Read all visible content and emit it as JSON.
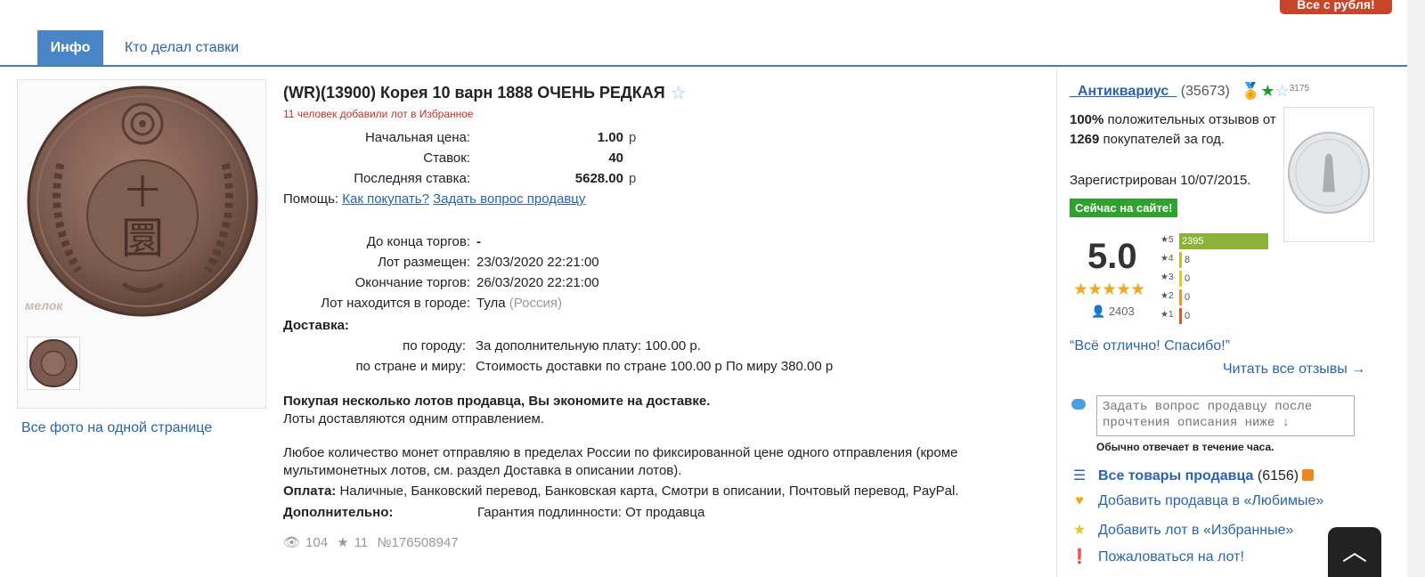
{
  "badge": "Все с рубля!",
  "tabs": [
    {
      "label": "Инфо"
    },
    {
      "label": "Кто делал ставки"
    }
  ],
  "photos": {
    "all_photos_label": "Все фото на одной странице",
    "watermark": "мелок"
  },
  "lot": {
    "title": "(WR)(13900) Корея 10 варн 1888 ОЧЕНЬ РЕДКАЯ",
    "fav_count_text": "11 человек добавили лот в Избранное",
    "start_price_label": "Начальная цена:",
    "start_price": "1.00",
    "bids_label": "Ставок:",
    "bids": "40",
    "last_bid_label": "Последняя ставка:",
    "last_bid": "5628.00",
    "currency": "р",
    "help_label": "Помощь:",
    "help_link_1": "Как покупать?",
    "help_link_2": "Задать вопрос продавцу",
    "ends_in_label": "До конца торгов:",
    "ends_in": "-",
    "placed_label": "Лот размещен:",
    "placed": "23/03/2020 22:21:00",
    "end_label": "Окончание торгов:",
    "end": "26/03/2020 22:21:00",
    "city_label": "Лот находится в городе:",
    "city": "Тула",
    "country": "(Россия)",
    "delivery_label": "Доставка:",
    "delivery_city_label": "по городу:",
    "delivery_city": "За дополнительную плату: 100.00 р.",
    "delivery_world_label": "по стране и миру:",
    "delivery_world": "Стоимость доставки по стране 100.00 р По миру 380.00 р",
    "save_bold": "Покупая несколько лотов продавца, Вы экономите на доставке.",
    "save_text": "Лоты доставляются одним отправлением.",
    "note_line1": "Любое количество монет отправляю в пределах России по фиксированной цене одного отправления (кроме",
    "note_line2": "мультимонетных лотов, см. раздел Доставка в описании лотов).",
    "payment_label": "Оплата:",
    "payment": "Наличные, Банковский перевод, Банковская карта, Смотри в описании, Почтовый перевод, PayPal.",
    "extra_label": "Дополнительно:",
    "extra": "Гарантия подлинности: От продавца",
    "views": "104",
    "stars": "11",
    "lot_number": "№176508947"
  },
  "seller": {
    "name": "_Антиквариус_",
    "count": "(35673)",
    "small_number": "3175",
    "positive_pct": "100%",
    "positive_text_1": " положительных отзывов от ",
    "positive_buyers": "1269",
    "positive_text_2": " покупателей за год.",
    "registered": "Зарегистрирован 10/07/2015.",
    "online": "Сейчас на сайте!",
    "rating": "5.0",
    "rating_stars": "★★★★★",
    "reviews_count": "2403",
    "bars": [
      {
        "label": "★5",
        "value": "2395",
        "count": 2395,
        "color": "#8cb23a"
      },
      {
        "label": "★4",
        "value": "8",
        "count": 8,
        "color": "#b5c72d"
      },
      {
        "label": "★3",
        "value": "0",
        "count": 0,
        "color": "#e8c52a"
      },
      {
        "label": "★2",
        "value": "0",
        "count": 0,
        "color": "#f0951f"
      },
      {
        "label": "★1",
        "value": "0",
        "count": 0,
        "color": "#e0582a"
      }
    ],
    "quote": "“Всё отлично! Спасибо!”",
    "read_all": "Читать все отзывы →",
    "ask_placeholder": "Задать вопрос продавцу после прочтения описания ниже ↓",
    "reply_note": "Обычно отвечает в течение часа.",
    "all_goods_label": "Все товары продавца",
    "all_goods_count": "(6156)",
    "add_fav_seller": "Добавить продавца в «Любимые»",
    "add_fav_lot": "Добавить лот в «Избранные»",
    "complain": "Пожаловаться на лот!"
  },
  "colors": {
    "accent": "#4a86c5",
    "link": "#2a63b0",
    "badge": "#c8452a",
    "online": "#2fa12e",
    "star": "#f2a81c"
  }
}
